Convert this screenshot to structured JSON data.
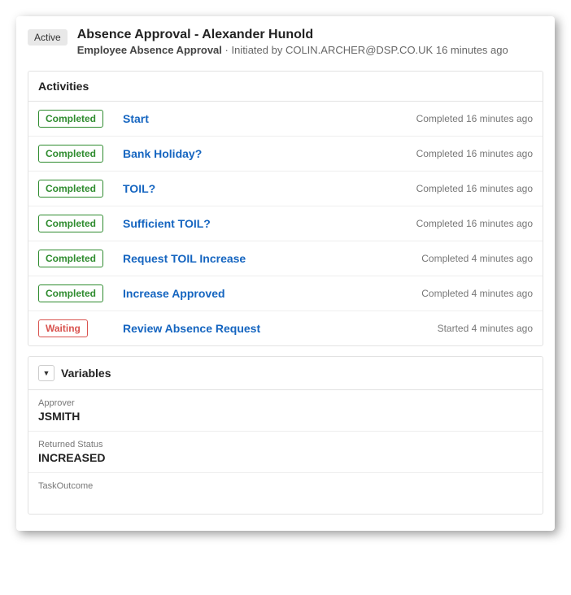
{
  "header": {
    "status": "Active",
    "title": "Absence Approval - Alexander Hunold",
    "workflow_name": "Employee Absence Approval",
    "initiated_separator": " · Initiated by ",
    "initiated_by": "COLIN.ARCHER@DSP.CO.UK",
    "initiated_time": " 16 minutes ago"
  },
  "activities": {
    "section_title": "Activities",
    "items": [
      {
        "status": "Completed",
        "status_class": "completed",
        "name": "Start",
        "time": "Completed 16 minutes ago"
      },
      {
        "status": "Completed",
        "status_class": "completed",
        "name": "Bank Holiday?",
        "time": "Completed 16 minutes ago"
      },
      {
        "status": "Completed",
        "status_class": "completed",
        "name": "TOIL?",
        "time": "Completed 16 minutes ago"
      },
      {
        "status": "Completed",
        "status_class": "completed",
        "name": "Sufficient TOIL?",
        "time": "Completed 16 minutes ago"
      },
      {
        "status": "Completed",
        "status_class": "completed",
        "name": "Request TOIL Increase",
        "time": "Completed 4 minutes ago"
      },
      {
        "status": "Completed",
        "status_class": "completed",
        "name": "Increase Approved",
        "time": "Completed 4 minutes ago"
      },
      {
        "status": "Waiting",
        "status_class": "waiting",
        "name": "Review Absence Request",
        "time": "Started 4 minutes ago"
      }
    ]
  },
  "variables": {
    "section_title": "Variables",
    "items": [
      {
        "label": "Approver",
        "value": "JSMITH"
      },
      {
        "label": "Returned Status",
        "value": "INCREASED"
      },
      {
        "label": "TaskOutcome",
        "value": ""
      }
    ]
  }
}
